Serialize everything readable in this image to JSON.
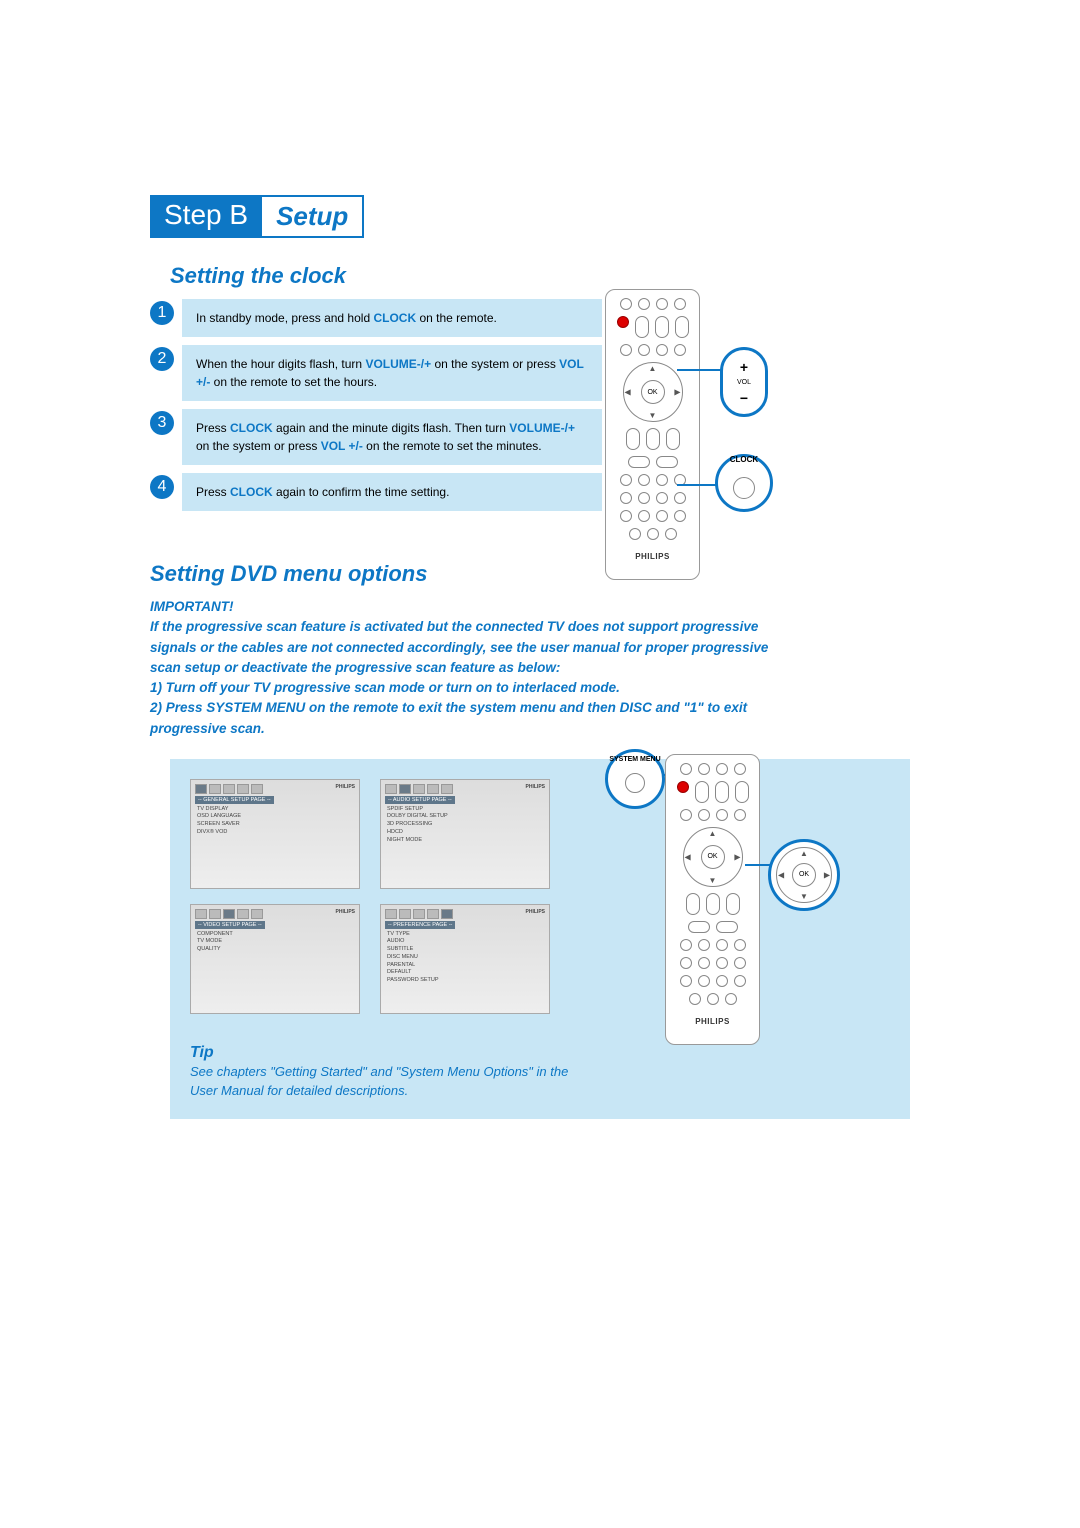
{
  "header": {
    "step": "Step B",
    "label": "Setup"
  },
  "clock": {
    "title": "Setting the clock",
    "steps": [
      {
        "num": "1",
        "pre": "In standby mode, press and hold ",
        "kw": "CLOCK",
        "post": " on the remote."
      },
      {
        "num": "2",
        "pre": "When the hour digits flash, turn ",
        "kw": "VOLUME-/+",
        "mid": " on the system or press ",
        "kw2": "VOL +/-",
        "post": " on the remote to set the hours."
      },
      {
        "num": "3",
        "pre": "Press ",
        "kw": "CLOCK",
        "mid": " again and the minute digits flash. Then turn ",
        "kw2": "VOLUME-/+",
        "mid2": " on the system or press ",
        "kw3": "VOL +/-",
        "post": " on the remote to set the minutes."
      },
      {
        "num": "4",
        "pre": "Press ",
        "kw": "CLOCK",
        "post": " again to confirm the time setting."
      }
    ],
    "callouts": {
      "vol": "VOL",
      "plus": "+",
      "minus": "−",
      "clock": "CLOCK"
    },
    "remote": {
      "ok": "OK",
      "brand": "PHILIPS"
    }
  },
  "dvd": {
    "title": "Setting DVD menu options",
    "important_label": "IMPORTANT!",
    "important_body": "If the progressive scan feature is activated but the connected TV does not support progressive signals or the cables are not connected accordingly, see the user manual for proper progressive scan setup or deactivate the progressive scan feature as below:",
    "important_step1": "1) Turn off your TV progressive scan mode or turn on to interlaced mode.",
    "important_step2": "2) Press SYSTEM MENU on the remote to exit the system menu and then DISC and \"1\" to exit progressive scan.",
    "panels": [
      {
        "title": "-- GENERAL SETUP PAGE --",
        "items": [
          "TV DISPLAY",
          "OSD LANGUAGE",
          "SCREEN SAVER",
          "DIVX® VOD"
        ]
      },
      {
        "title": "-- AUDIO SETUP PAGE --",
        "items": [
          "SPDIF SETUP",
          "DOLBY DIGITAL SETUP",
          "3D PROCESSING",
          "HDCD",
          "NIGHT MODE"
        ]
      },
      {
        "title": "-- VIDEO SETUP PAGE --",
        "items": [
          "COMPONENT",
          "TV MODE",
          "QUALITY"
        ]
      },
      {
        "title": "-- PREFERENCE PAGE --",
        "items": [
          "TV TYPE",
          "AUDIO",
          "SUBTITLE",
          "DISC MENU",
          "PARENTAL",
          "DEFAULT",
          "PASSWORD SETUP"
        ]
      }
    ],
    "panel_brand": "PHILIPS",
    "callouts": {
      "system_menu": "SYSTEM MENU",
      "ok": "OK"
    },
    "remote": {
      "ok": "OK",
      "brand": "PHILIPS"
    },
    "tip_title": "Tip",
    "tip_body": "See chapters \"Getting Started\" and \"System Menu Options\" in the User Manual for detailed descriptions."
  }
}
